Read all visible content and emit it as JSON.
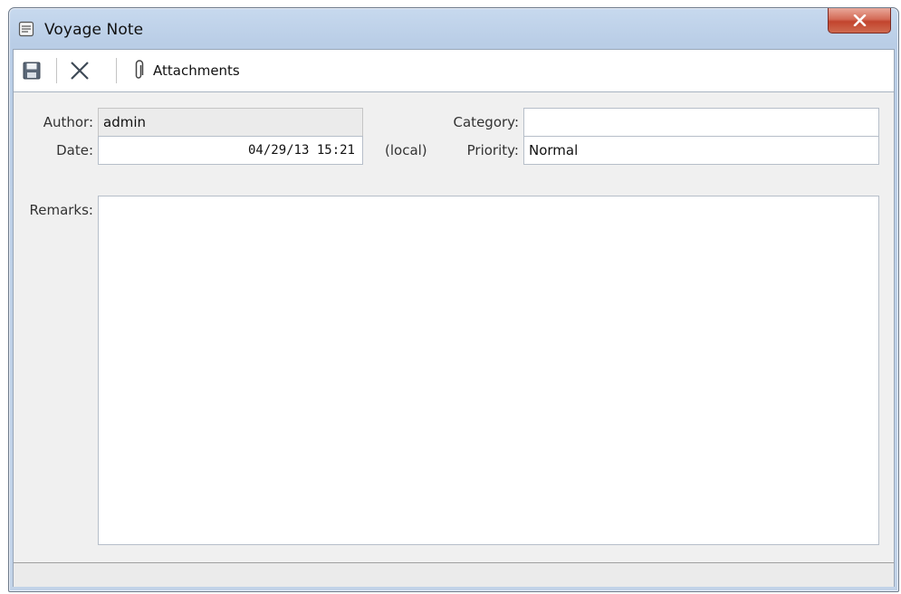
{
  "window": {
    "title": "Voyage Note",
    "close_icon": "close-icon"
  },
  "toolbar": {
    "save_icon": "save-icon",
    "delete_icon": "delete-icon",
    "attachments_icon": "paperclip-icon",
    "attachments_label": "Attachments"
  },
  "form": {
    "author_label": "Author:",
    "author_value": "admin",
    "date_label": "Date:",
    "date_value": "04/29/13 15:21",
    "timezone_label": "(local)",
    "category_label": "Category:",
    "category_value": "",
    "priority_label": "Priority:",
    "priority_value": "Normal",
    "remarks_label": "Remarks:",
    "remarks_value": ""
  },
  "colors": {
    "title_bar": "#c7d9ee",
    "close_button": "#c2442e",
    "client_background": "#f0f0f0"
  }
}
